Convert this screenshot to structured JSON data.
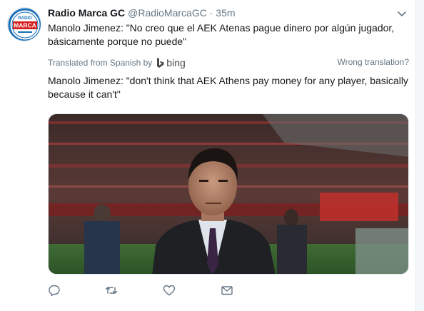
{
  "tweet": {
    "author_name": "Radio Marca GC",
    "author_handle": "@RadioMarcaGC",
    "separator": "·",
    "time": "35m",
    "original_text": "Manolo Jimenez: \"No creo que el AEK Atenas pague dinero por algún jugador, básicamente porque no puede\"",
    "translated_from": "Translated from Spanish by",
    "translator": "bing",
    "wrong_translation": "Wrong translation?",
    "translated_text": "Manolo Jimenez: \"don't think that AEK Athens pay money for any player, basically because it can't\""
  },
  "avatar": {
    "top_text": "RADIO",
    "brand_text": "MARCA",
    "brand_color": "#d41c1c",
    "ring_color": "#1a6fb8"
  },
  "icons": {
    "caret": "chevron-down-icon",
    "reply": "reply-icon",
    "retweet": "retweet-icon",
    "like": "heart-icon",
    "dm": "envelope-icon"
  },
  "colors": {
    "muted": "#657786",
    "text": "#14171a",
    "icon": "#657786"
  }
}
